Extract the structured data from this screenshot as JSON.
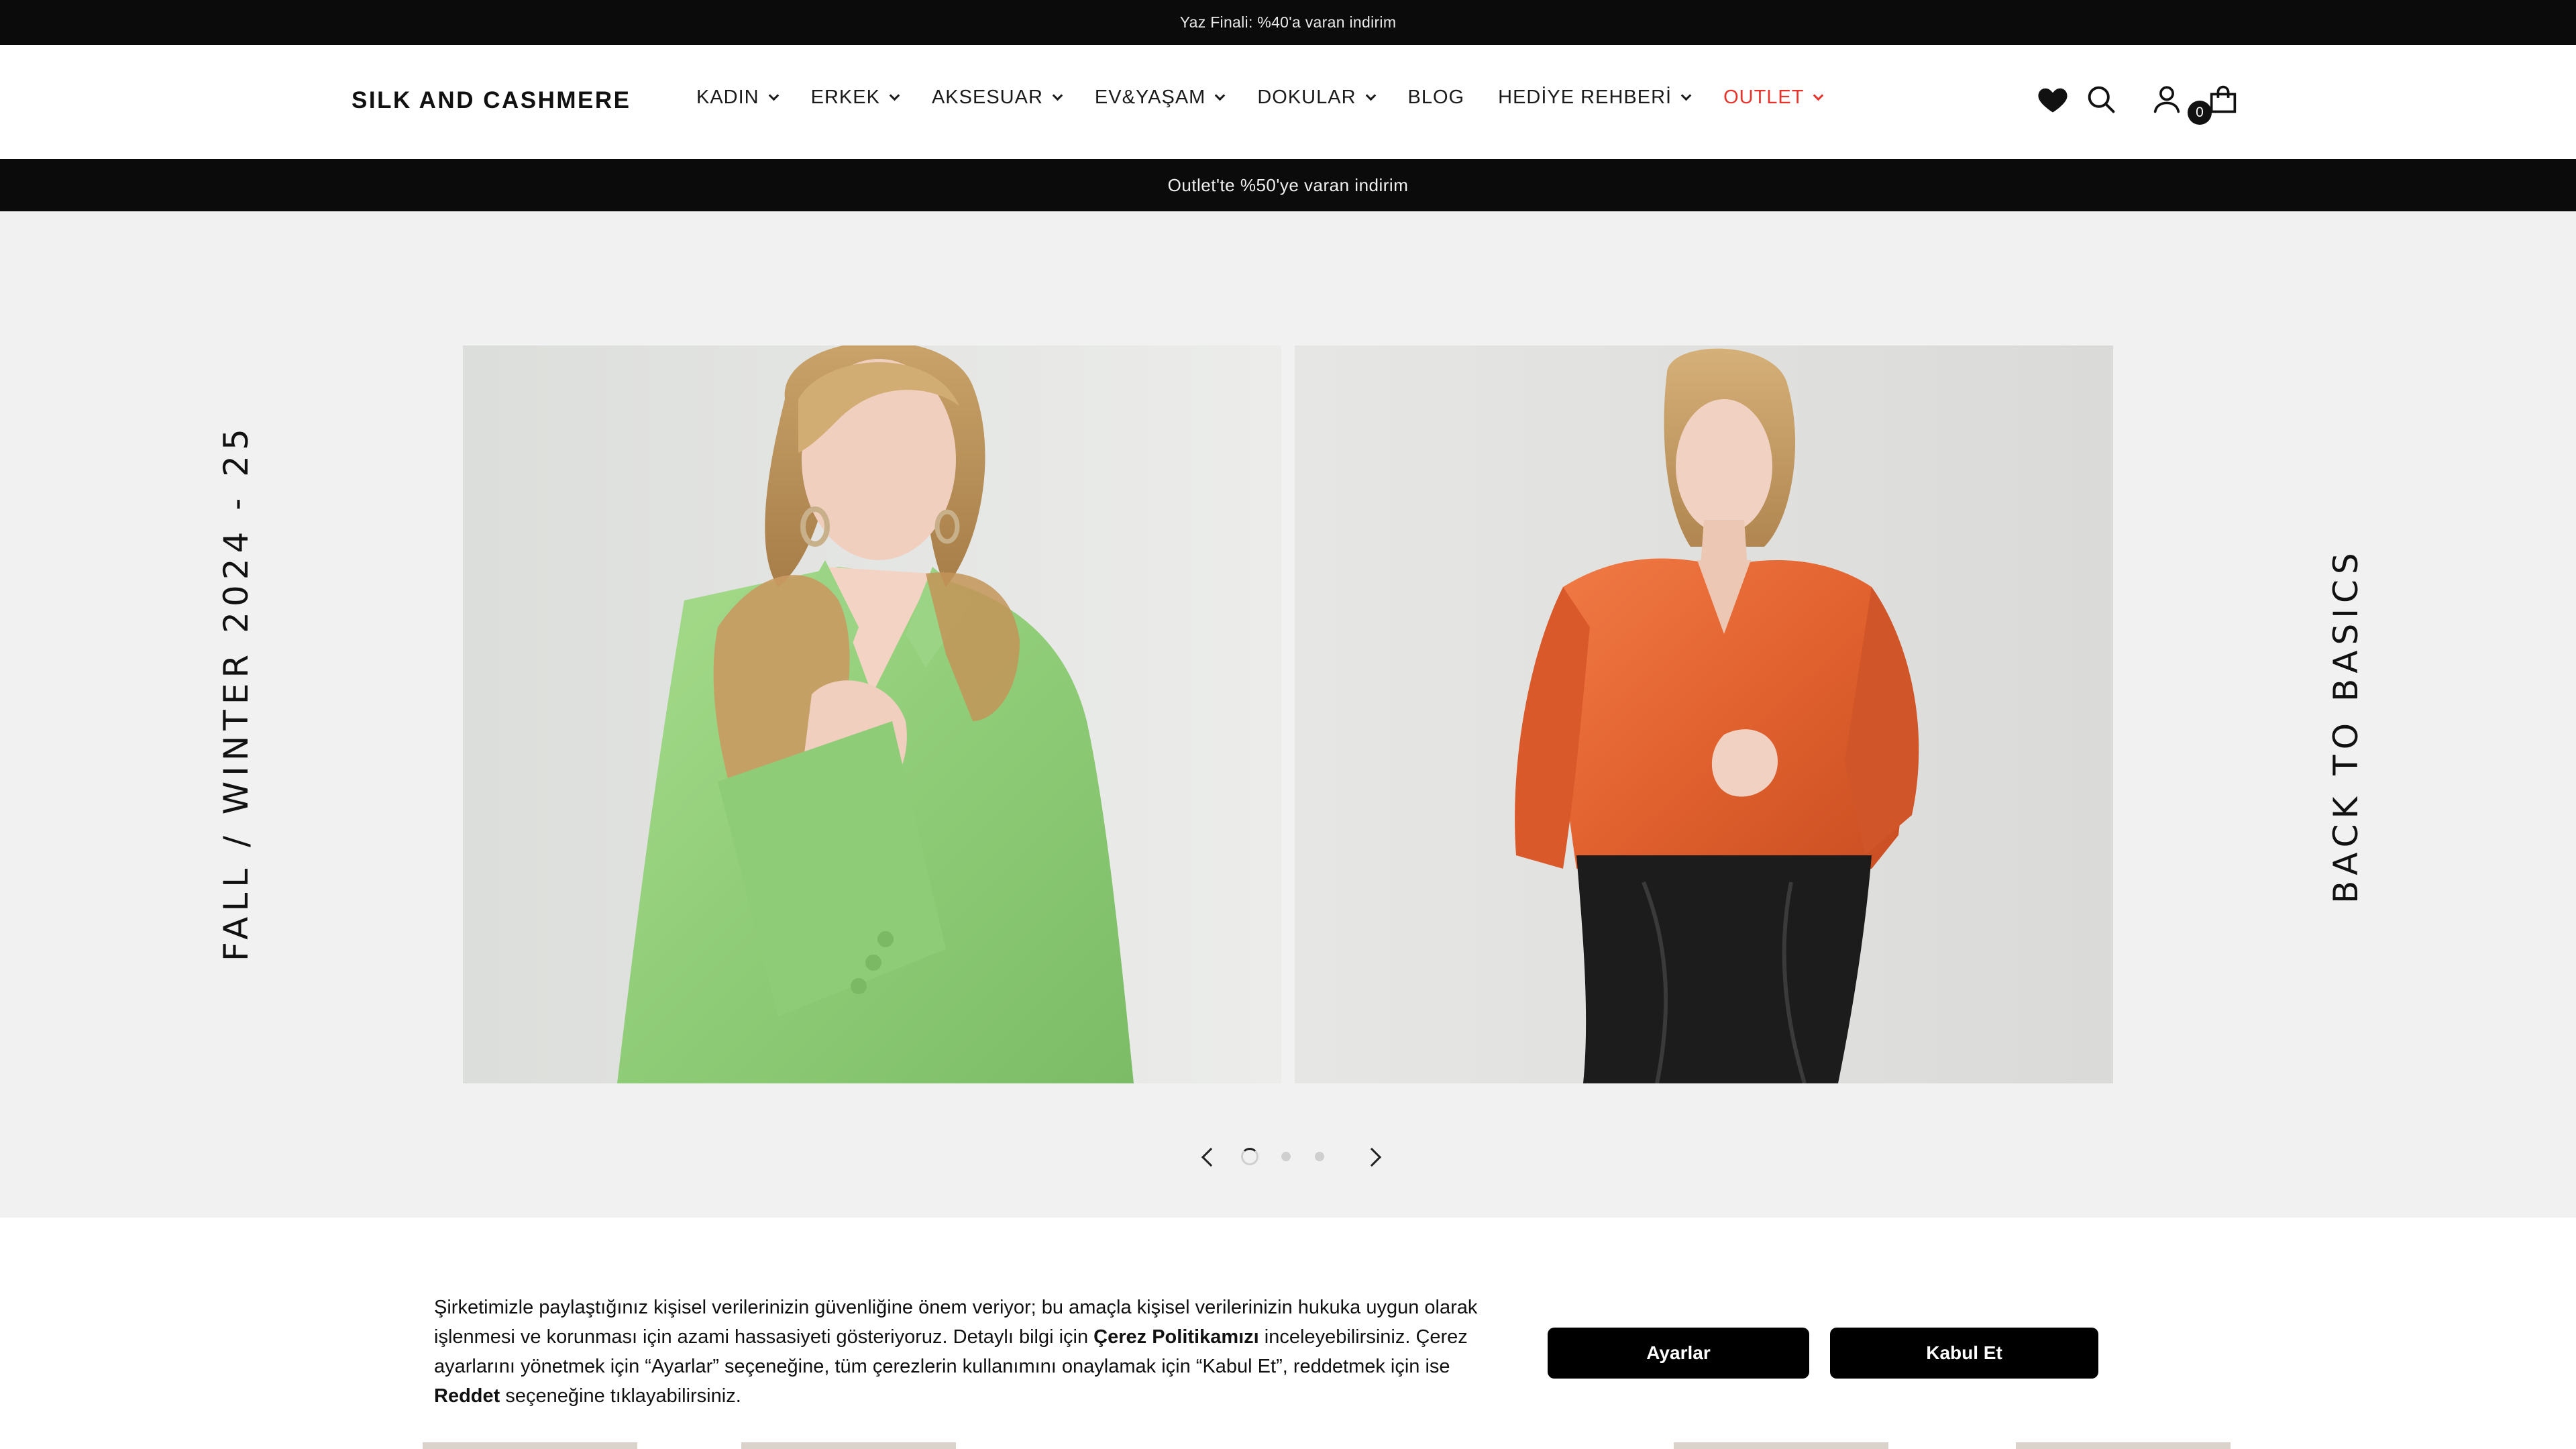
{
  "promo_top": {
    "text": "Yaz Finali: %40'a varan indirim"
  },
  "header": {
    "logo": "SILK AND CASHMERE",
    "nav": [
      {
        "label": "KADIN",
        "dropdown": true
      },
      {
        "label": "ERKEK",
        "dropdown": true
      },
      {
        "label": "AKSESUAR",
        "dropdown": true
      },
      {
        "label": "EV&YAŞAM",
        "dropdown": true
      },
      {
        "label": "DOKULAR",
        "dropdown": true
      },
      {
        "label": "BLOG",
        "dropdown": false
      },
      {
        "label": "HEDİYE REHBERİ",
        "dropdown": true
      },
      {
        "label": "OUTLET",
        "dropdown": true,
        "color": "#e6342b"
      }
    ],
    "icons": [
      "heart-icon",
      "search-icon",
      "user-icon",
      "bag-icon"
    ],
    "cart_count": "0"
  },
  "promo_outlet": {
    "text": "Outlet'te %50'ye varan indirim"
  },
  "hero": {
    "left_side_text": "FALL / WINTER 2024 - 25",
    "right_side_text": "BACK TO BASICS",
    "slides": 3,
    "active_slide": 1
  },
  "cookie": {
    "text_1": "Şirketimizle paylaştığınız kişisel verilerinizin güvenliğine önem veriyor; bu amaçla kişisel verilerinizin hukuka uygun olarak işlenmesi ve korunması için azami hassasiyeti gösteriyoruz. Detaylı bilgi için ",
    "link_policy": "Çerez Politikamızı",
    "text_2": " inceleyebilirsiniz. Çerez ayarlarını yönetmek için “Ayarlar” seçeneğine, tüm çerezlerin kullanımını onaylamak için “Kabul Et”, reddetmek için ise ",
    "link_reject": "Reddet",
    "text_3": " seçeneğine tıklayabilirsiniz.",
    "settings_button": "Ayarlar",
    "accept_button": "Kabul Et"
  },
  "colors": {
    "accent": "#e6342b",
    "bar": "#0b0b0b",
    "hero_bg": "#f1f1f1"
  }
}
